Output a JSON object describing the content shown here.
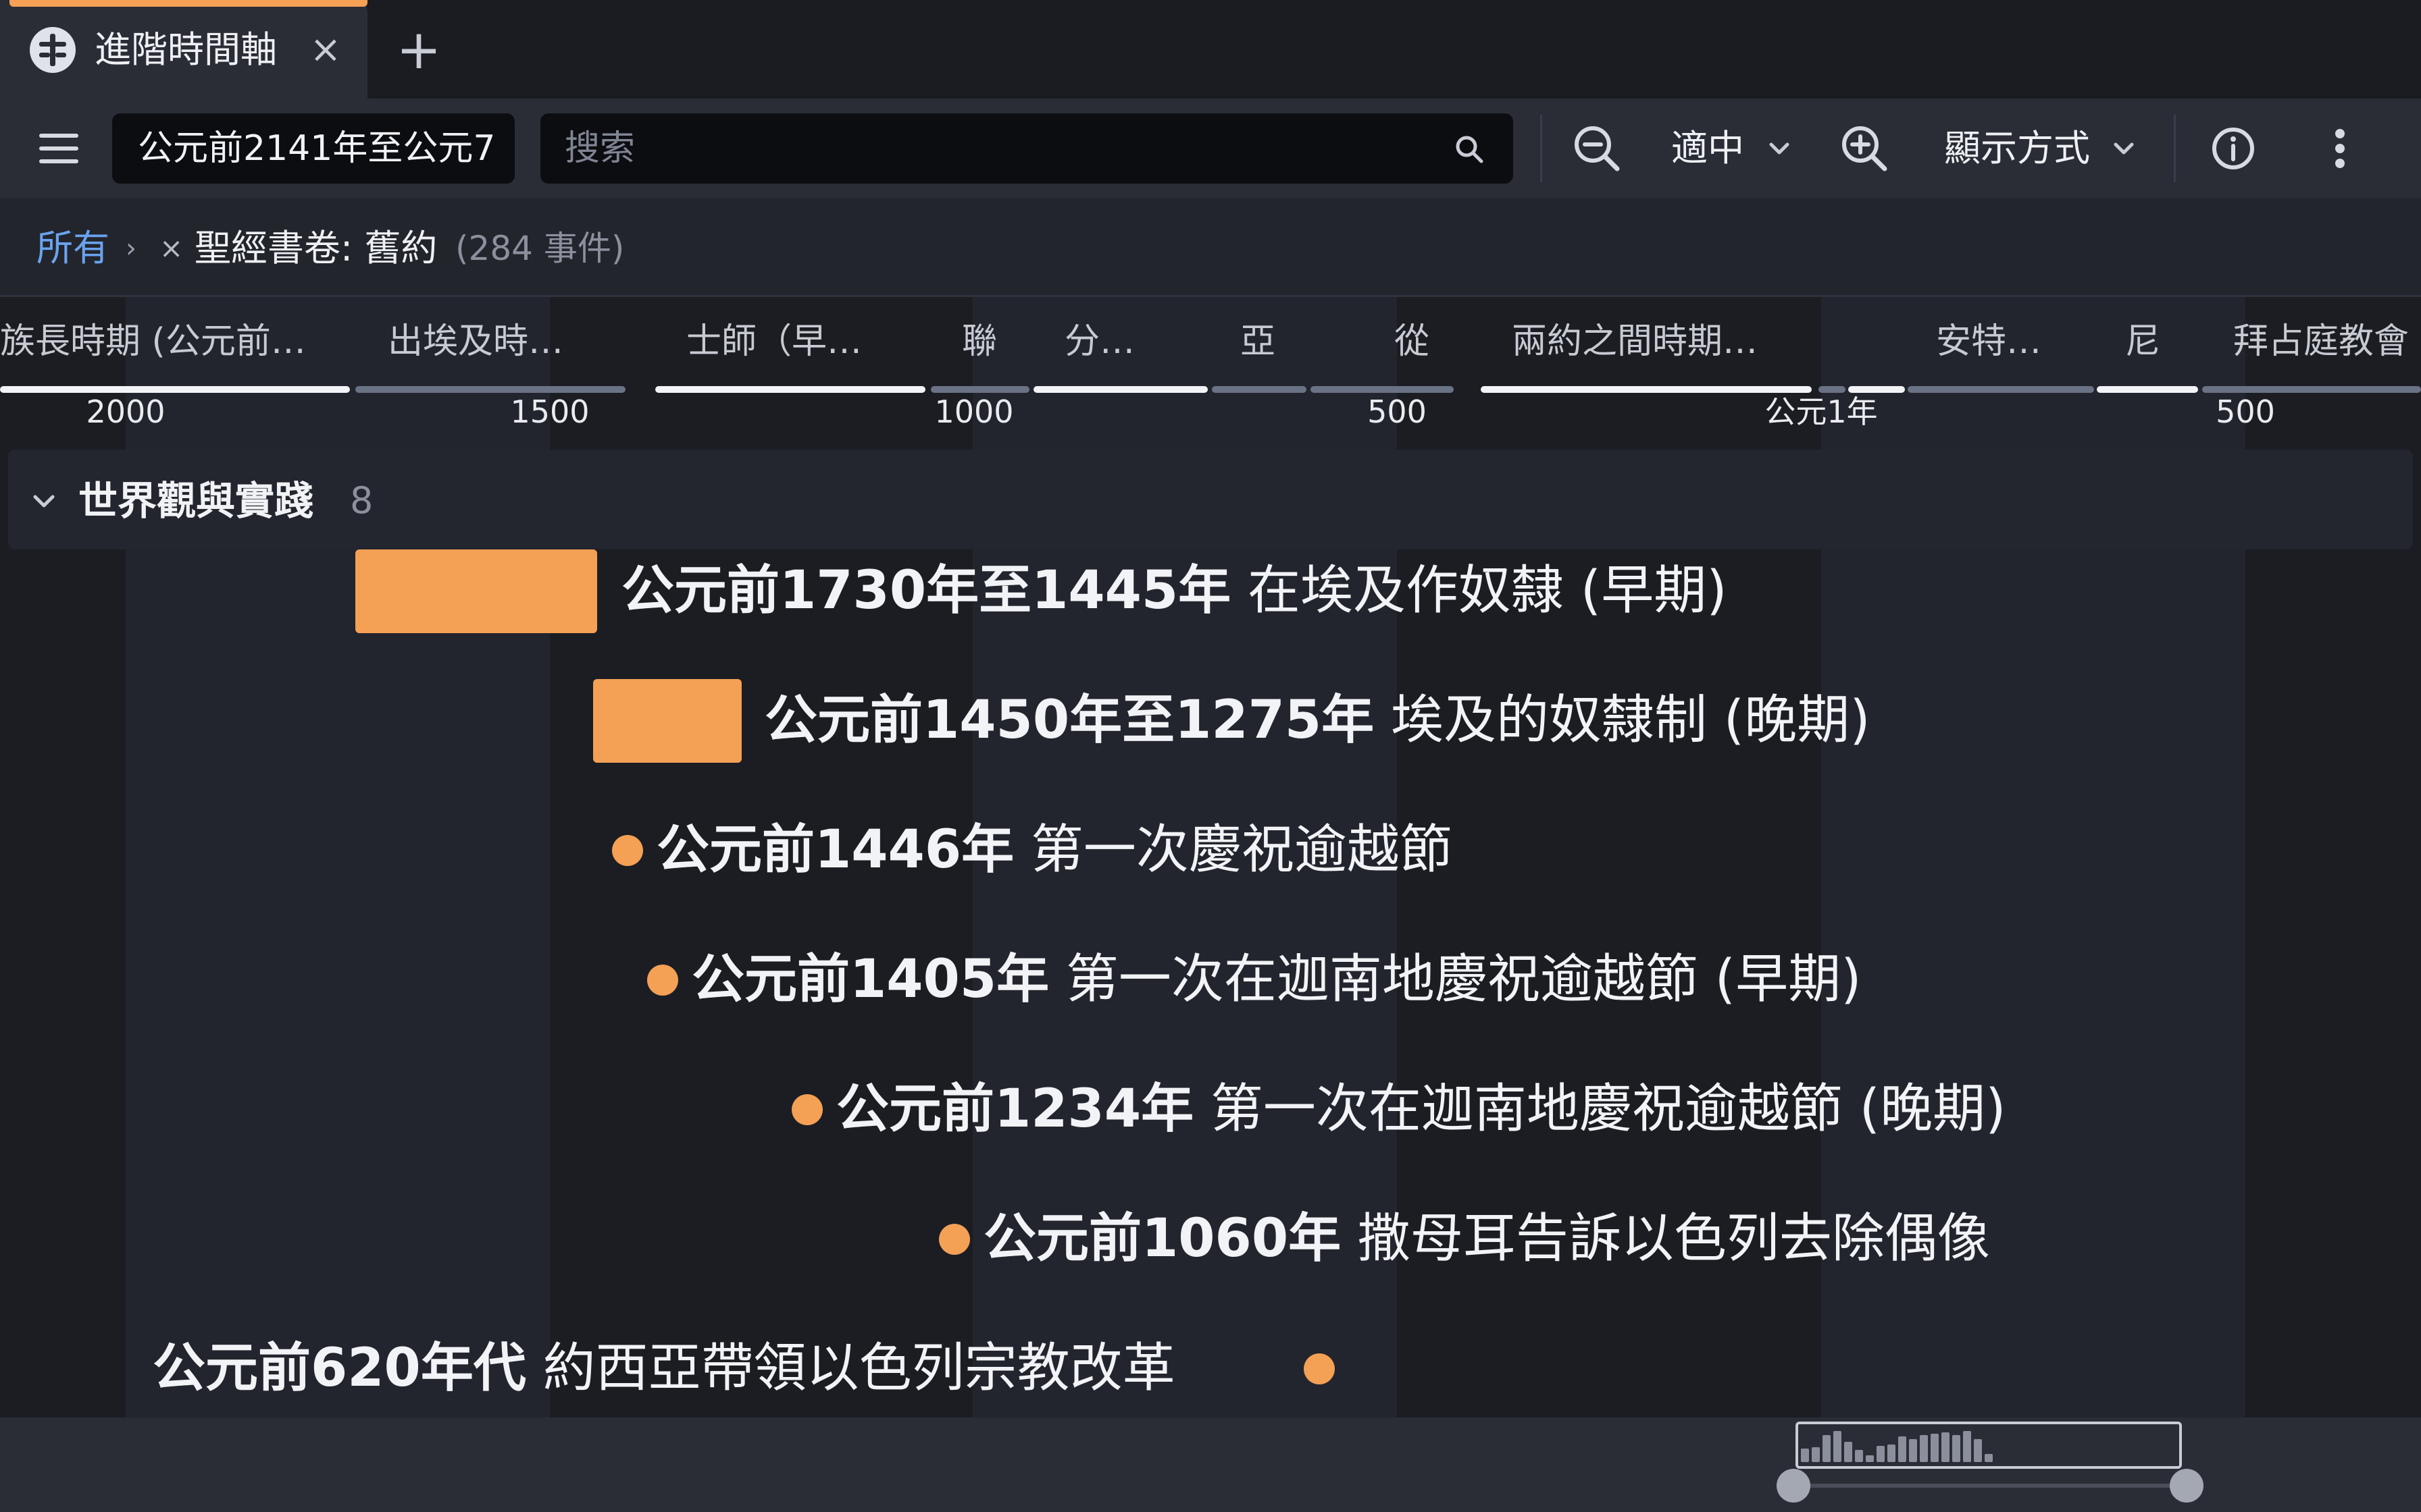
{
  "tab": {
    "title": "進階時間軸",
    "icon": "timeline-app-icon",
    "close_label": "×",
    "add_label": "+"
  },
  "toolbar": {
    "range_text": "公元前2141年至公元7",
    "search_placeholder": "搜索",
    "fit_label": "適中",
    "display_label": "顯示方式",
    "icons": [
      "menu-icon",
      "search-icon",
      "zoom-out-icon",
      "chevron-down-icon",
      "zoom-in-icon",
      "info-icon",
      "more-vertical-icon"
    ]
  },
  "breadcrumb": {
    "all_label": "所有",
    "separator": "›",
    "remove_label": "×",
    "filter_label": "聖經書卷: 舊約",
    "count_label": "(284 事件)"
  },
  "eras": [
    {
      "label": "族長時期 (公元前…"
    },
    {
      "label": "出埃及時…"
    },
    {
      "label": "士師（早…"
    },
    {
      "label": "聯"
    },
    {
      "label": "分…"
    },
    {
      "label": "亞"
    },
    {
      "label": "從"
    },
    {
      "label": "兩約之間時期…"
    },
    {
      "label": "安特…"
    },
    {
      "label": "尼"
    },
    {
      "label": "拜占庭教會"
    }
  ],
  "axis": {
    "ticks": [
      "2000",
      "1500",
      "1000",
      "500",
      "公元1年",
      "500"
    ]
  },
  "group": {
    "title": "世界觀與實踐",
    "count": "8"
  },
  "events": [
    {
      "date": "公元前1730年至1445年",
      "text": "在埃及作奴隸 (早期)",
      "kind": "range"
    },
    {
      "date": "公元前1450年至1275年",
      "text": "埃及的奴隸制 (晚期)",
      "kind": "range"
    },
    {
      "date": "公元前1446年",
      "text": "第一次慶祝逾越節",
      "kind": "point"
    },
    {
      "date": "公元前1405年",
      "text": "第一次在迦南地慶祝逾越節 (早期)",
      "kind": "point"
    },
    {
      "date": "公元前1234年",
      "text": "第一次在迦南地慶祝逾越節 (晚期)",
      "kind": "point"
    },
    {
      "date": "公元前1060年",
      "text": "撒母耳告訴以色列去除偶像",
      "kind": "point"
    },
    {
      "date": "公元前620年代",
      "text": "約西亞帶領以色列宗教改革",
      "kind": "point"
    }
  ],
  "colors": {
    "accent": "#f4a055",
    "link": "#6aa3ee",
    "background": "#1b1d23",
    "toolbar": "#2a2d36"
  }
}
